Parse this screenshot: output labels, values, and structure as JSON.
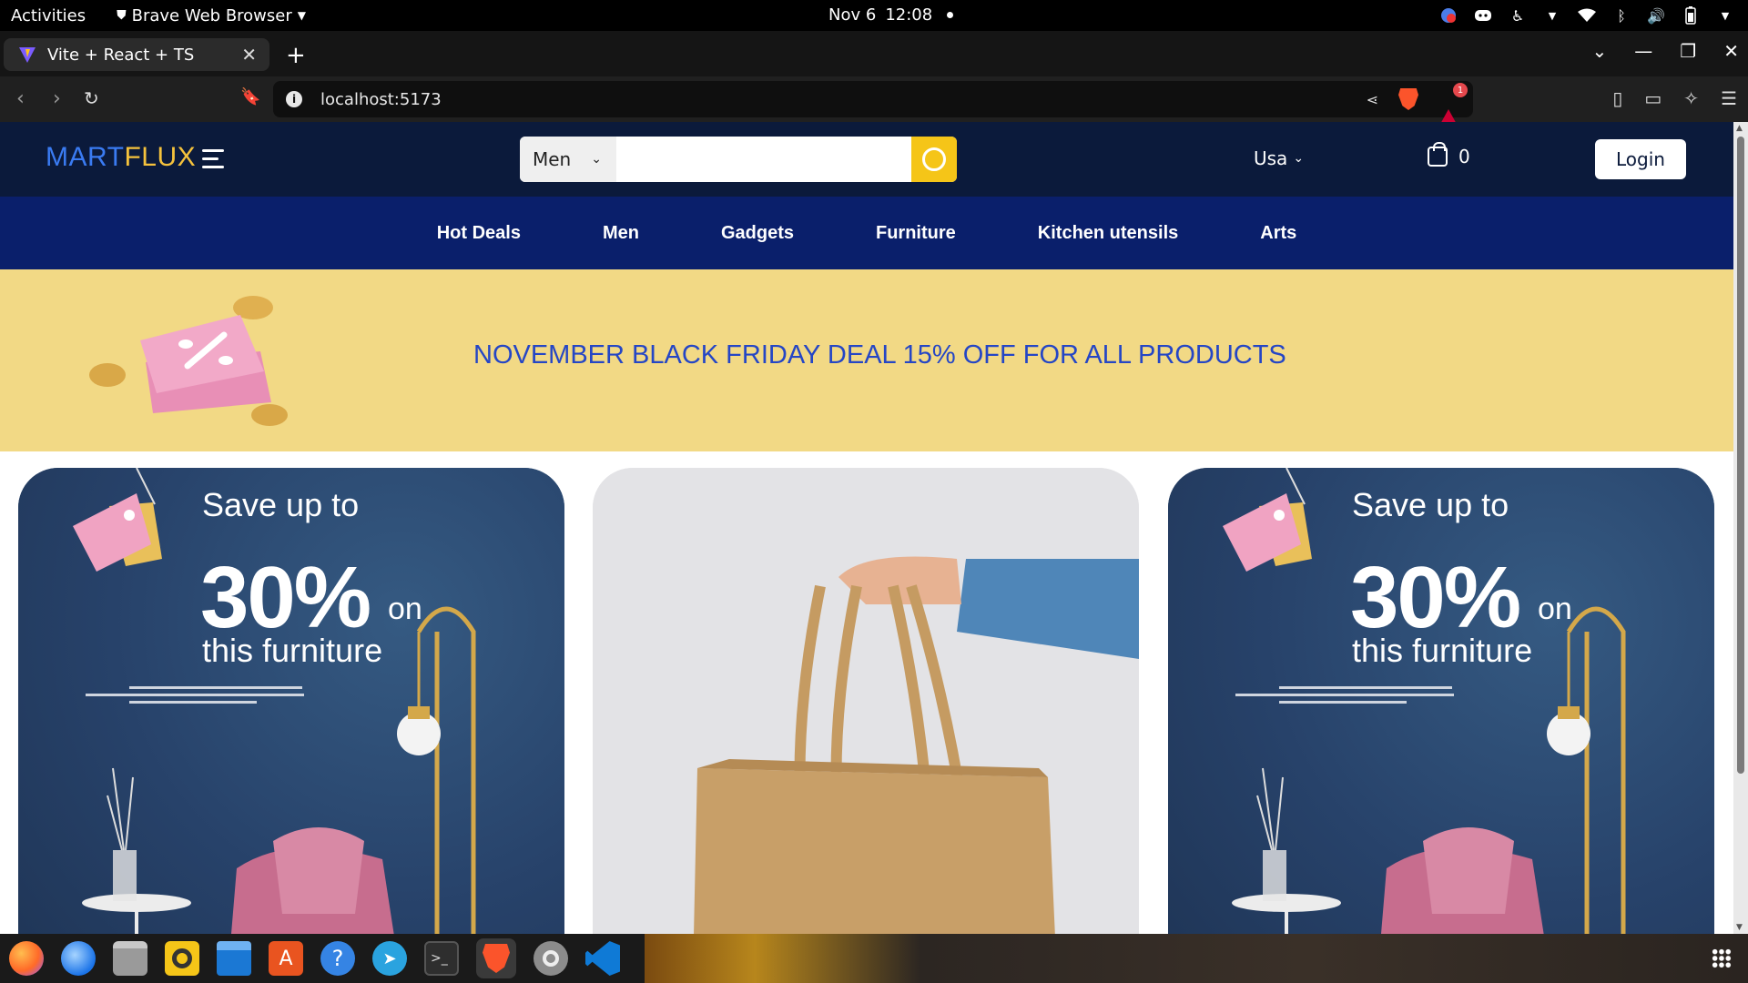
{
  "os": {
    "activities": "Activities",
    "app_menu": "Brave Web Browser",
    "date": "Nov 6",
    "time": "12:08"
  },
  "browser": {
    "tab_title": "Vite + React + TS",
    "url": "localhost:5173",
    "notification_count": "1"
  },
  "site": {
    "logo_part1": "MART",
    "logo_part2": "FLUX",
    "search": {
      "category": "Men",
      "placeholder": ""
    },
    "country": "Usa",
    "cart_count": "0",
    "login_label": "Login",
    "categories": [
      "Hot Deals",
      "Men",
      "Gadgets",
      "Furniture",
      "Kitchen utensils",
      "Arts"
    ],
    "promo_text": "NOVEMBER BLACK FRIDAY DEAL 15% OFF FOR ALL PRODUCTS",
    "cards": [
      {
        "line1": "Save up to",
        "percent": "30%",
        "on": "on",
        "line3": "this furniture"
      },
      {
        "alt": "Tote bag"
      },
      {
        "line1": "Save up to",
        "percent": "30%",
        "on": "on",
        "line3": "this furniture"
      }
    ]
  },
  "colors": {
    "header_bg": "#0b1a3b",
    "nav_bg": "#0a1f6b",
    "promo_bg": "#f2d985",
    "promo_text": "#2546c5",
    "accent_yellow": "#f5c518",
    "logo_blue": "#3a7bf2",
    "logo_yellow": "#f5c23c"
  },
  "icons": [
    "firefox-icon",
    "thunderbird-icon",
    "files-icon",
    "rhythmbox-icon",
    "writer-icon",
    "software-icon",
    "help-icon",
    "telegram-icon",
    "terminal-icon",
    "brave-icon",
    "settings-icon",
    "vscode-icon",
    "app-grid-icon"
  ]
}
